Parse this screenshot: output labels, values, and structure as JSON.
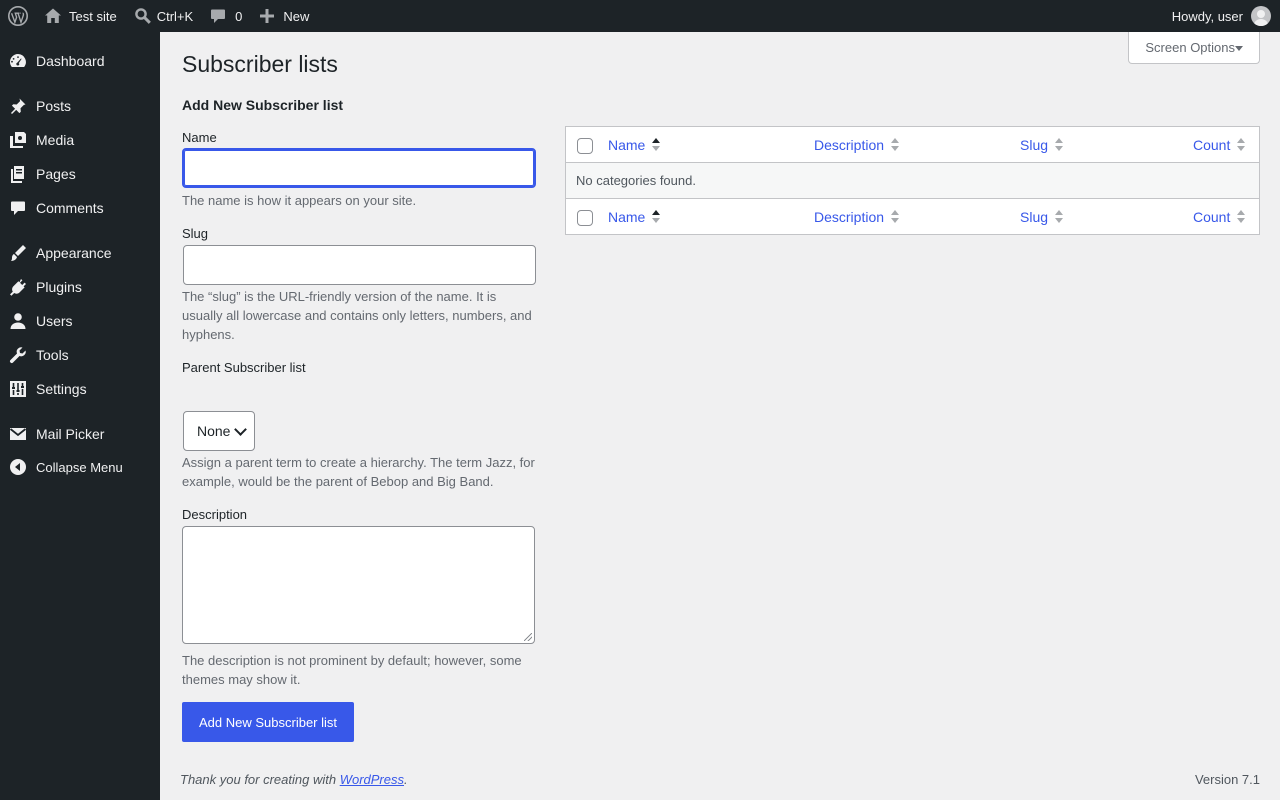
{
  "admin_bar": {
    "site_name": "Test site",
    "search_shortcut": "Ctrl+K",
    "comments_count": "0",
    "new_label": "New",
    "greeting": "Howdy, user"
  },
  "sidebar": {
    "items": [
      {
        "label": "Dashboard",
        "icon": "dashboard-icon"
      },
      {
        "label": "Posts",
        "icon": "pin-icon"
      },
      {
        "label": "Media",
        "icon": "media-icon"
      },
      {
        "label": "Pages",
        "icon": "pages-icon"
      },
      {
        "label": "Comments",
        "icon": "comments-icon"
      },
      {
        "label": "Appearance",
        "icon": "brush-icon"
      },
      {
        "label": "Plugins",
        "icon": "plugin-icon"
      },
      {
        "label": "Users",
        "icon": "user-icon"
      },
      {
        "label": "Tools",
        "icon": "wrench-icon"
      },
      {
        "label": "Settings",
        "icon": "settings-icon"
      },
      {
        "label": "Mail Picker",
        "icon": "envelope-icon"
      }
    ],
    "collapse_label": "Collapse Menu"
  },
  "screen_options": "Screen Options",
  "page_title": "Subscriber lists",
  "form": {
    "heading": "Add New Subscriber list",
    "name_label": "Name",
    "name_value": "",
    "name_help": "The name is how it appears on your site.",
    "slug_label": "Slug",
    "slug_value": "",
    "slug_help": "The “slug” is the URL-friendly version of the name. It is usually all lowercase and contains only letters, numbers, and hyphens.",
    "parent_label": "Parent Subscriber list",
    "parent_selected": "None",
    "parent_help": "Assign a parent term to create a hierarchy. The term Jazz, for example, would be the parent of Bebop and Big Band.",
    "description_label": "Description",
    "description_value": "",
    "description_help": "The description is not prominent by default; however, some themes may show it.",
    "submit_label": "Add New Subscriber list"
  },
  "table": {
    "columns": [
      "Name",
      "Description",
      "Slug",
      "Count"
    ],
    "sorted_column": "Name",
    "empty_message": "No categories found."
  },
  "footer": {
    "thanks_text": "Thank you for creating with",
    "thanks_link": "WordPress",
    "thanks_end": ".",
    "version": "Version 7.1"
  },
  "colors": {
    "accent": "#3858e9",
    "admin_dark": "#1d2327",
    "background": "#f0f0f1"
  }
}
